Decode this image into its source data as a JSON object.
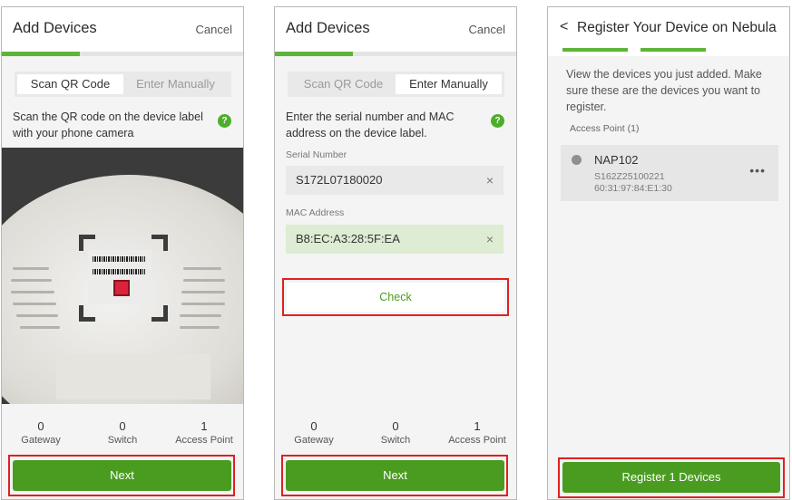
{
  "screen1": {
    "title": "Add Devices",
    "cancel": "Cancel",
    "tab_scan": "Scan QR Code",
    "tab_manual": "Enter Manually",
    "instruction": "Scan the QR code on the device label with your phone camera",
    "help": "?",
    "counts": [
      {
        "num": "0",
        "label": "Gateway"
      },
      {
        "num": "0",
        "label": "Switch"
      },
      {
        "num": "1",
        "label": "Access Point"
      }
    ],
    "next": "Next"
  },
  "screen2": {
    "title": "Add Devices",
    "cancel": "Cancel",
    "tab_scan": "Scan QR Code",
    "tab_manual": "Enter Manually",
    "instruction": "Enter the serial number and MAC address on the device label.",
    "help": "?",
    "serial_label": "Serial Number",
    "serial_value": "S172L07180020",
    "mac_label": "MAC Address",
    "mac_value": "B8:EC:A3:28:5F:EA",
    "clear": "×",
    "check": "Check",
    "counts": [
      {
        "num": "0",
        "label": "Gateway"
      },
      {
        "num": "0",
        "label": "Switch"
      },
      {
        "num": "1",
        "label": "Access Point"
      }
    ],
    "next": "Next"
  },
  "screen3": {
    "back": "<",
    "title": "Register Your Device on Nebula",
    "body": "View the devices you just added. Make sure these are the devices you want to register.",
    "section": "Access Point (1)",
    "device": {
      "name": "NAP102",
      "serial": "S162Z25100221",
      "mac": "60:31:97:84:E1:30",
      "more": "•••"
    },
    "register": "Register 1 Devices"
  },
  "colors": {
    "accent_green": "#4a9c21",
    "progress_green": "#5cb53a",
    "highlight_red": "#e02020",
    "mac_field_bg": "#ddecd2"
  }
}
